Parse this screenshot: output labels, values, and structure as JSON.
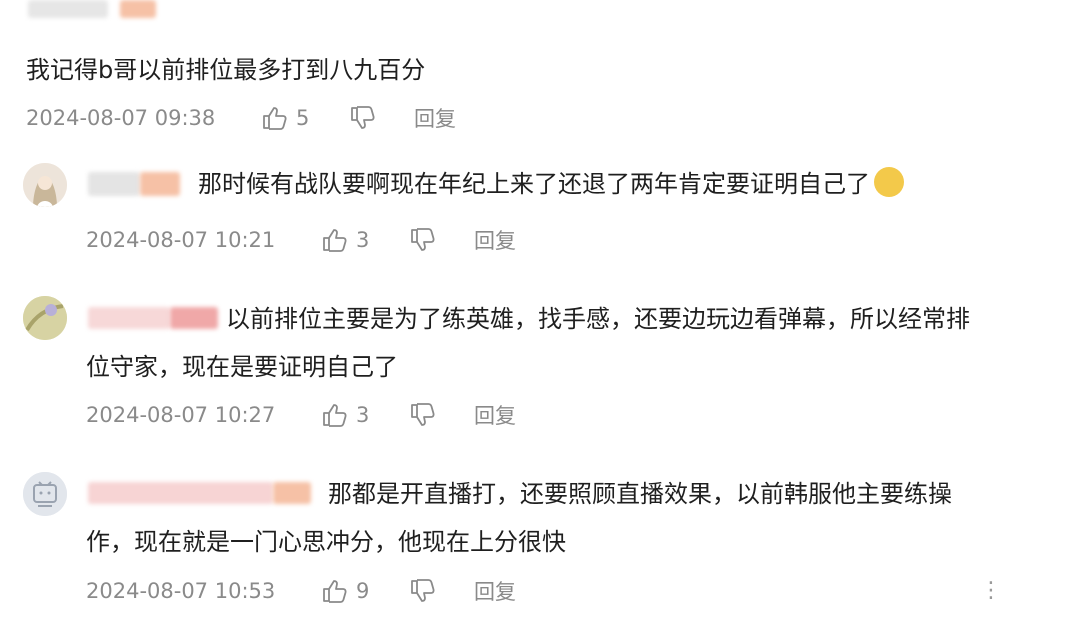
{
  "comments": [
    {
      "text": "我记得b哥以前排位最多打到八九百分",
      "time": "2024-08-07 09:38",
      "likes": "5",
      "reply_label": "回复"
    },
    {
      "text": "那时候有战队要啊现在年纪上来了还退了两年肯定要证明自己了",
      "time": "2024-08-07 10:21",
      "likes": "3",
      "reply_label": "回复",
      "emoji": "laughing-cry-emoji"
    },
    {
      "text_line1": "以前排位主要是为了练英雄，找手感，还要边玩边看弹幕，所以经常排",
      "text_line2": "位守家，现在是要证明自己了",
      "time": "2024-08-07 10:27",
      "likes": "3",
      "reply_label": "回复"
    },
    {
      "text_line1": "那都是开直播打，还要照顾直播效果，以前韩服他主要练操",
      "text_line2": "作，现在就是一门心思冲分，他现在上分很快",
      "time": "2024-08-07 10:53",
      "likes": "9",
      "reply_label": "回复",
      "more_label": "⋮"
    }
  ],
  "colors": {
    "text": "#1f1f1f",
    "meta": "#8a8a8a",
    "blur_pink": "#f4c9c9",
    "blur_orange": "#f6c1a6"
  }
}
